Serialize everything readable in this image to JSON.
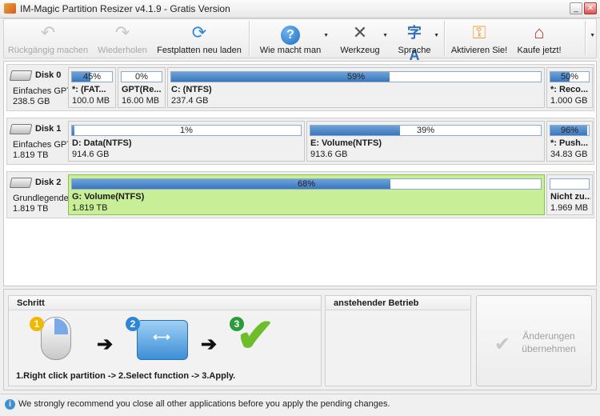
{
  "window": {
    "title": "IM-Magic Partition Resizer v4.1.9 - Gratis Version",
    "minimize": "_",
    "close": "✕"
  },
  "toolbar": {
    "undo": "Rückgängig machen",
    "redo": "Wiederholen",
    "reload": "Festplatten neu laden",
    "help": "Wie macht man",
    "tools": "Werkzeug",
    "language": "Sprache",
    "activate": "Aktivieren Sie!",
    "buy": "Kaufe jetzt!"
  },
  "disks": [
    {
      "name": "Disk 0",
      "type": "Einfaches GPT",
      "size": "238.5 GB",
      "partitions": [
        {
          "label": "*: (FAT...",
          "size": "100.0 MB",
          "percent_text": "45%",
          "percent": 45
        },
        {
          "label": "GPT(Re...",
          "size": "16.00 MB",
          "percent_text": "0%",
          "percent": 0
        },
        {
          "label": "C: (NTFS)",
          "size": "237.4 GB",
          "percent_text": "59%",
          "percent": 59
        },
        {
          "label": "*: Reco...",
          "size": "1.000 GB",
          "percent_text": "50%",
          "percent": 50
        }
      ]
    },
    {
      "name": "Disk 1",
      "type": "Einfaches GPT",
      "size": "1.819 TB",
      "partitions": [
        {
          "label": "D: Data(NTFS)",
          "size": "914.6 GB",
          "percent_text": "1%",
          "percent": 1
        },
        {
          "label": "E: Volume(NTFS)",
          "size": "913.6 GB",
          "percent_text": "39%",
          "percent": 39
        },
        {
          "label": "*: Push...",
          "size": "34.83 GB",
          "percent_text": "96%",
          "percent": 96
        }
      ]
    },
    {
      "name": "Disk 2",
      "type": "Grundlegende",
      "size": "1.819 TB",
      "partitions": [
        {
          "label": "G: Volume(NTFS)",
          "size": "1.819 TB",
          "percent_text": "68%",
          "percent": 68,
          "selected": true
        },
        {
          "label": "Nicht zu...",
          "size": "1.969 MB",
          "percent_text": "",
          "percent": 0
        }
      ]
    }
  ],
  "steps_panel": {
    "title": "Schritt",
    "step_numbers": [
      "1",
      "2",
      "3"
    ],
    "description": "1.Right click partition -> 2.Select function -> 3.Apply."
  },
  "pending_panel": {
    "title": "anstehender Betrieb"
  },
  "apply_button": {
    "line1": "Änderungen",
    "line2": "übernehmen"
  },
  "status_bar": {
    "text": "We strongly recommend you close all other applications before you apply the pending changes."
  },
  "colors": {
    "bar_fill": "#3b76bd",
    "selected_partition": "#c8ee98",
    "accent_orange": "#e8a33a"
  }
}
